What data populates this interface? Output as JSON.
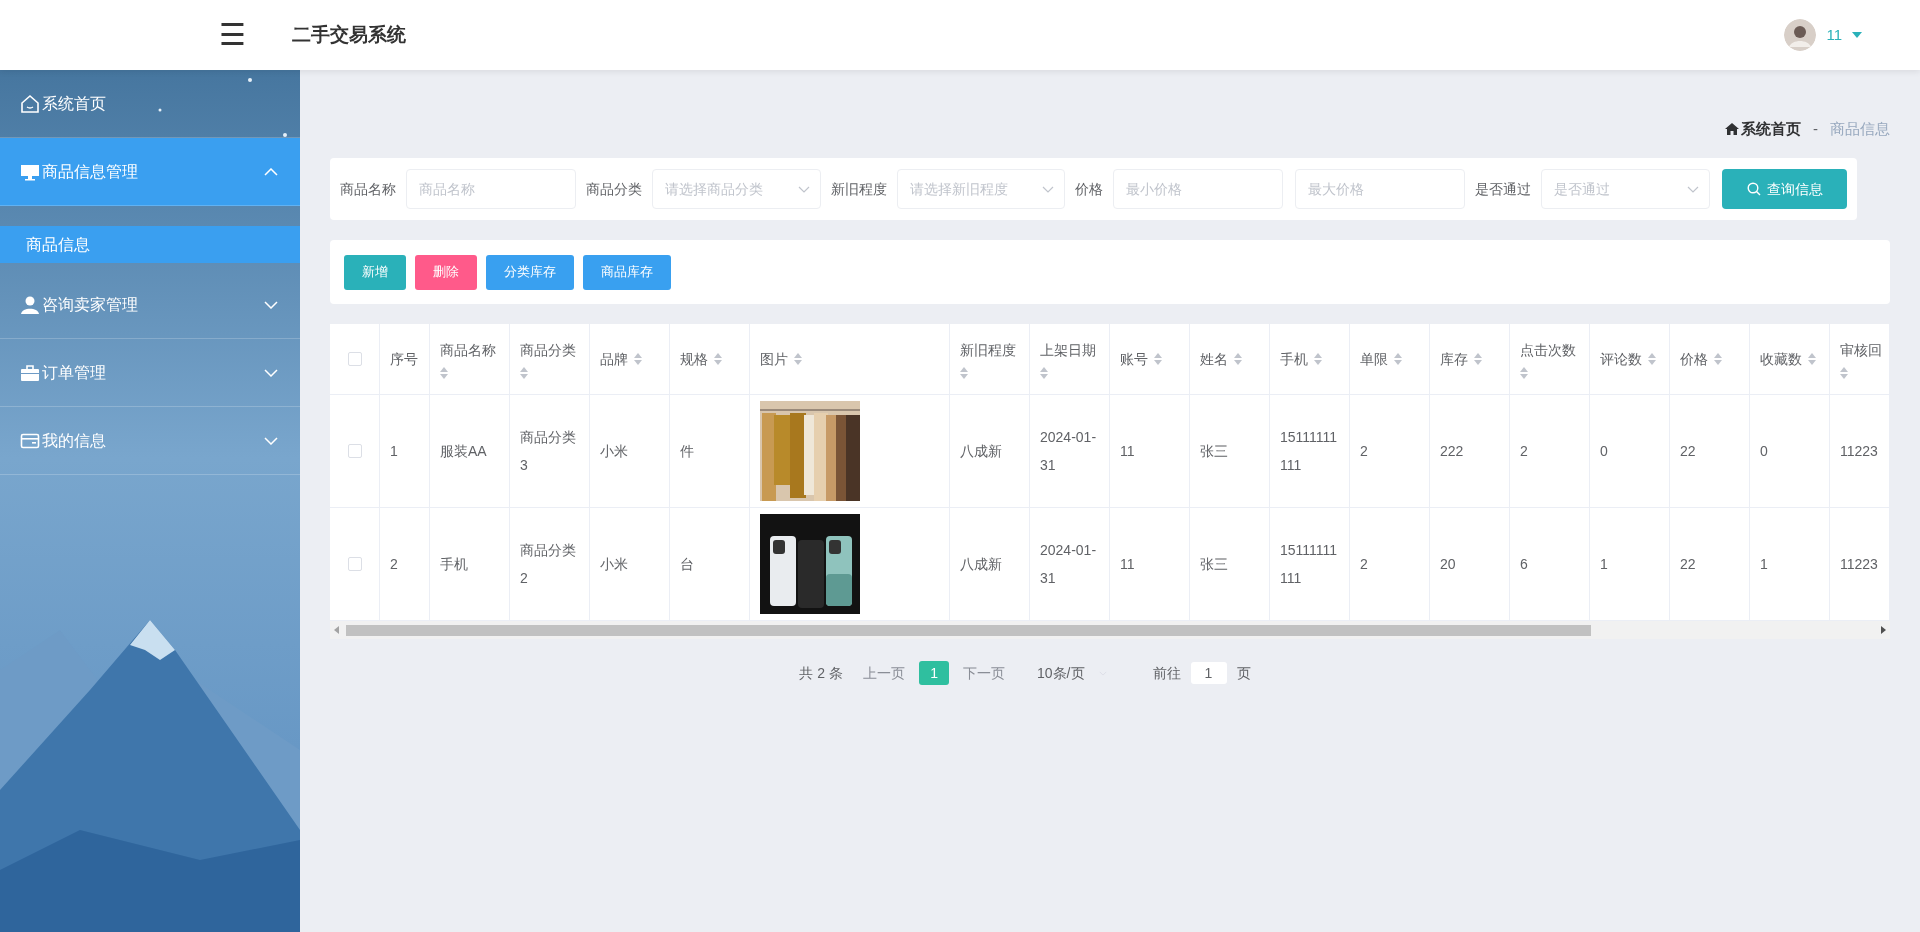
{
  "header": {
    "menu_icon": "☰",
    "title": "二手交易系统",
    "user": "11"
  },
  "sidebar": {
    "items": [
      {
        "label": "系统首页",
        "expandable": false,
        "expanded": false
      },
      {
        "label": "商品信息管理",
        "expandable": true,
        "expanded": true,
        "children": [
          {
            "label": "商品信息",
            "selected": true
          }
        ]
      },
      {
        "label": "咨询卖家管理",
        "expandable": true,
        "expanded": false
      },
      {
        "label": "订单管理",
        "expandable": true,
        "expanded": false
      },
      {
        "label": "我的信息",
        "expandable": true,
        "expanded": false
      }
    ]
  },
  "breadcrumb": {
    "home": "系统首页",
    "separator": "-",
    "current": "商品信息"
  },
  "search": {
    "fields": [
      {
        "label": "商品名称",
        "kind": "input",
        "placeholder": "商品名称"
      },
      {
        "label": "商品分类",
        "kind": "select",
        "placeholder": "请选择商品分类"
      },
      {
        "label": "新旧程度",
        "kind": "select",
        "placeholder": "请选择新旧程度"
      },
      {
        "label": "价格",
        "kind": "input",
        "placeholder": "最小价格"
      },
      {
        "kind": "input",
        "placeholder": "最大价格"
      },
      {
        "label": "是否通过",
        "kind": "select",
        "placeholder": "是否通过"
      }
    ],
    "button": "查询信息"
  },
  "actions": [
    {
      "label": "新增",
      "color": "#2ab1b9"
    },
    {
      "label": "删除",
      "color": "#ff5a8a"
    },
    {
      "label": "分类库存",
      "color": "#39a0f0"
    },
    {
      "label": "商品库存",
      "color": "#39a0f0"
    }
  ],
  "table": {
    "select_all_checked": false,
    "columns": [
      {
        "label": "序号",
        "sortable": false
      },
      {
        "label": "商品名称",
        "sortable": true
      },
      {
        "label": "商品分类",
        "sortable": true
      },
      {
        "label": "品牌",
        "sortable": true
      },
      {
        "label": "规格",
        "sortable": true
      },
      {
        "label": "图片",
        "sortable": true
      },
      {
        "label": "新旧程度",
        "sortable": true
      },
      {
        "label": "上架日期",
        "sortable": true
      },
      {
        "label": "账号",
        "sortable": true
      },
      {
        "label": "姓名",
        "sortable": true
      },
      {
        "label": "手机",
        "sortable": true
      },
      {
        "label": "单限",
        "sortable": true
      },
      {
        "label": "库存",
        "sortable": true
      },
      {
        "label": "点击次数",
        "sortable": true
      },
      {
        "label": "评论数",
        "sortable": true
      },
      {
        "label": "价格",
        "sortable": true
      },
      {
        "label": "收藏数",
        "sortable": true
      },
      {
        "label": "审核回",
        "sortable": true
      }
    ],
    "rows": [
      {
        "checked": false,
        "cells": [
          "1",
          "服装AA",
          "商品分类3",
          "小米",
          "件",
          {
            "kind": "picture"
          },
          "八成新",
          "2024-01-31",
          "11",
          "张三",
          "15111111111",
          "2",
          "222",
          "2",
          "0",
          "22",
          "0",
          "11223"
        ]
      },
      {
        "checked": false,
        "cells": [
          "2",
          "手机",
          "商品分类2",
          "小米",
          "台",
          {
            "kind": "picture"
          },
          "八成新",
          "2024-01-31",
          "11",
          "张三",
          "15111111111",
          "2",
          "20",
          "6",
          "1",
          "22",
          "1",
          "11223"
        ]
      }
    ]
  },
  "pagination": {
    "total": "共 2 条",
    "prev": "上一页",
    "pages": [
      {
        "label": "1",
        "selected": true
      }
    ],
    "next": "下一页",
    "page_size": "10条/页",
    "goto_label": "前往",
    "goto_value": "1",
    "goto_suffix": "页"
  }
}
